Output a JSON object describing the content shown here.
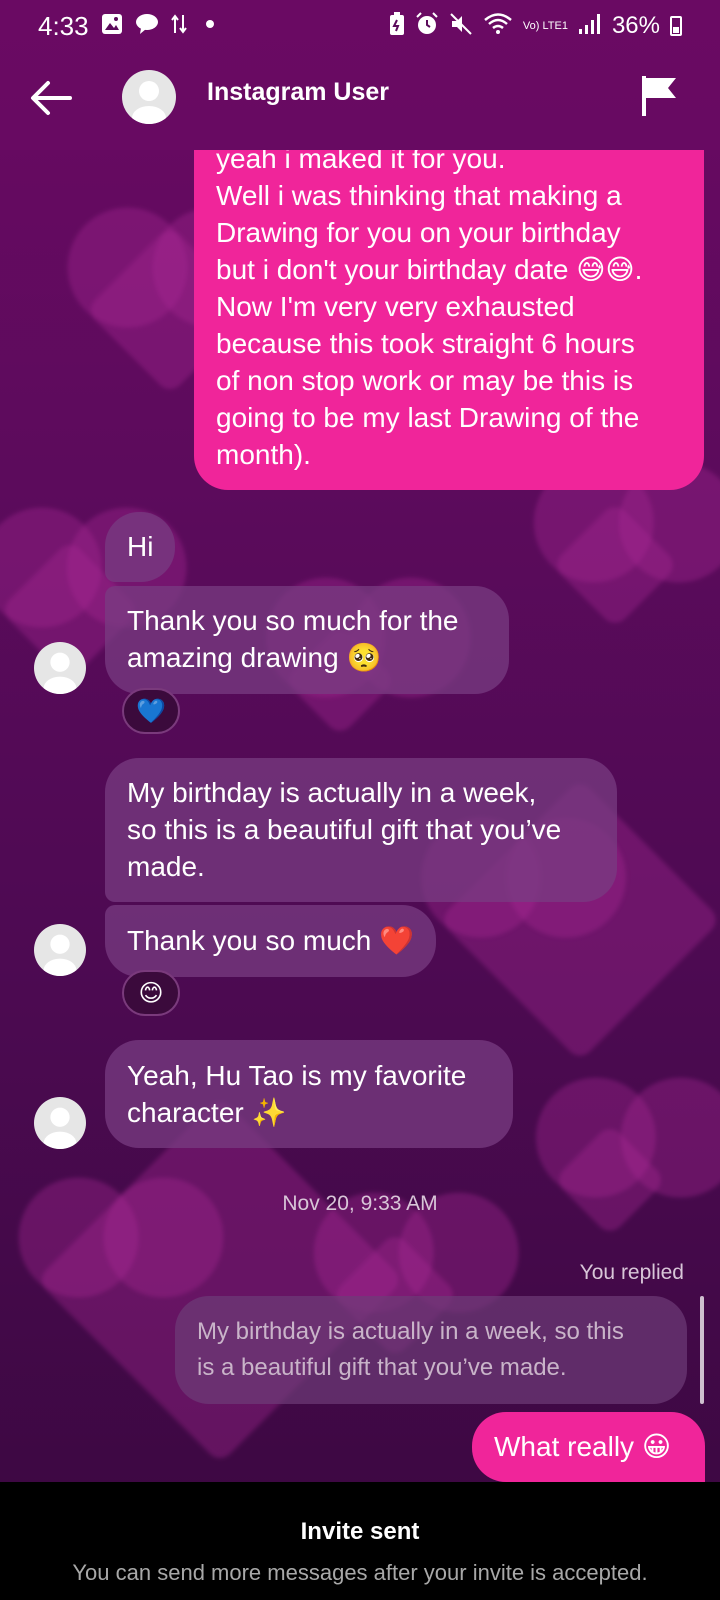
{
  "status_bar": {
    "time": "4:33",
    "battery": "36%",
    "network": "Vo) LTE1",
    "icons": [
      "image-icon",
      "chat-icon",
      "data-transfer-icon",
      "dot-icon",
      "battery-saver-icon",
      "alarm-icon",
      "mute-icon",
      "wifi-icon",
      "signal-icon",
      "battery-icon"
    ]
  },
  "header": {
    "title": "Instagram User",
    "back_icon": "arrow-left-icon",
    "flag_icon": "flag-icon"
  },
  "messages": {
    "outgoing_long": [
      "yeah i maked it for you.",
      "Well i was thinking that making a",
      "Drawing for you on your birthday",
      "but i don't your birthday date 😅😅.",
      "Now I'm very very exhausted",
      "because this took straight 6 hours",
      "of non stop work or may be this is",
      "going to be my last Drawing of the",
      "month)."
    ],
    "in_hi": "Hi",
    "in_thanks_drawing": [
      "Thank you so much for the",
      "amazing drawing 🥺"
    ],
    "reaction_1": "💙",
    "in_birthday": [
      "My birthday is actually in a week,",
      "so this is a beautiful gift that you’ve",
      "made."
    ],
    "in_thanks": "Thank you so much ❤️",
    "reaction_2": "😊",
    "in_hutao": [
      "Yeah, Hu Tao is my favorite",
      "character ✨"
    ],
    "timestamp": "Nov 20, 9:33 AM",
    "you_replied": "You replied",
    "quoted": [
      "My birthday is actually in a week, so this",
      "is a beautiful gift that you’ve made."
    ],
    "out_reply": "What really 😀"
  },
  "footer": {
    "title": "Invite sent",
    "subtitle": "You can send more messages after your invite is accepted."
  }
}
